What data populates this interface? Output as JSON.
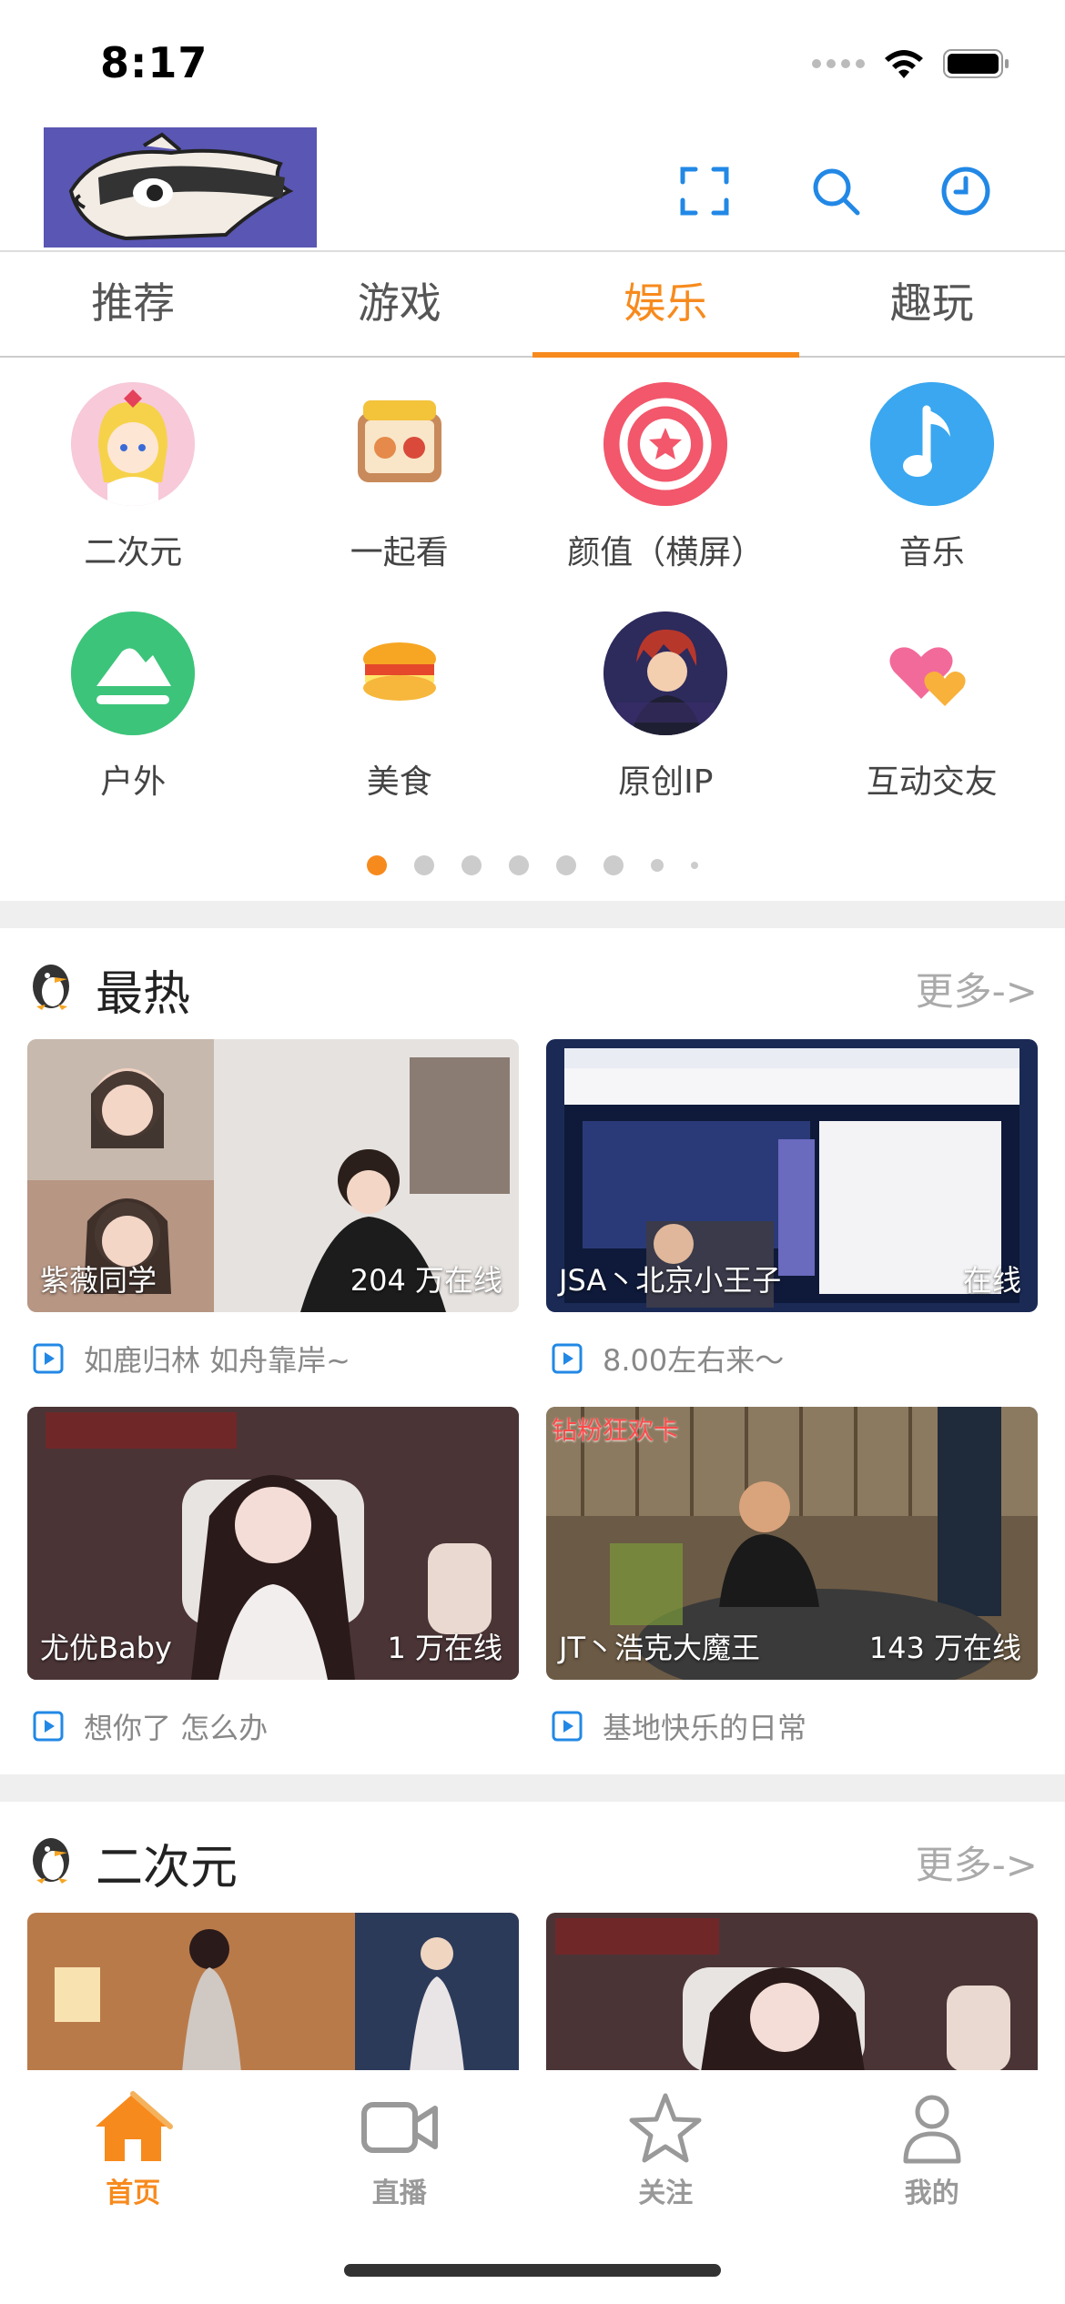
{
  "status": {
    "time": "8:17"
  },
  "header": {
    "icons": [
      "scan-icon",
      "search-icon",
      "history-clock-icon"
    ]
  },
  "tabs": [
    {
      "label": "推荐",
      "active": false
    },
    {
      "label": "游戏",
      "active": false
    },
    {
      "label": "娱乐",
      "active": true
    },
    {
      "label": "趣玩",
      "active": false
    }
  ],
  "categories": [
    {
      "label": "二次元",
      "color": "#f7c9d9"
    },
    {
      "label": "一起看",
      "color": "#ffffff"
    },
    {
      "label": "颜值（横屏）",
      "color": "#f2576b"
    },
    {
      "label": "音乐",
      "color": "#3aa7f0"
    },
    {
      "label": "户外",
      "color": "#3cc47a"
    },
    {
      "label": "美食",
      "color": "#ffffff"
    },
    {
      "label": "原创IP",
      "color": "#2d2a5c"
    },
    {
      "label": "互动交友",
      "color": "#ffffff"
    }
  ],
  "pager": {
    "total": 8,
    "active": 0
  },
  "sections": [
    {
      "title": "最热",
      "more": "更多->",
      "cards": [
        {
          "name": "紫薇同学",
          "count": "204 万在线",
          "desc": "如鹿归林 如舟靠岸~"
        },
        {
          "name": "JSA丶北京小王子",
          "count": "在线",
          "desc": "8.00左右来～"
        },
        {
          "name": "尤优Baby",
          "count": "1 万在线",
          "desc": "想你了 怎么办"
        },
        {
          "name": "JT丶浩克大魔王",
          "count": "143 万在线",
          "desc": "基地快乐的日常"
        }
      ]
    },
    {
      "title": "二次元",
      "more": "更多->"
    }
  ],
  "thumb_labels": {
    "card4_banner": "钻粉狂欢卡"
  },
  "accent_color": "#f78a1d",
  "bottom_nav": [
    {
      "label": "首页",
      "icon": "home-icon",
      "active": true
    },
    {
      "label": "直播",
      "icon": "video-camera-icon",
      "active": false
    },
    {
      "label": "关注",
      "icon": "star-icon",
      "active": false
    },
    {
      "label": "我的",
      "icon": "person-icon",
      "active": false
    }
  ]
}
